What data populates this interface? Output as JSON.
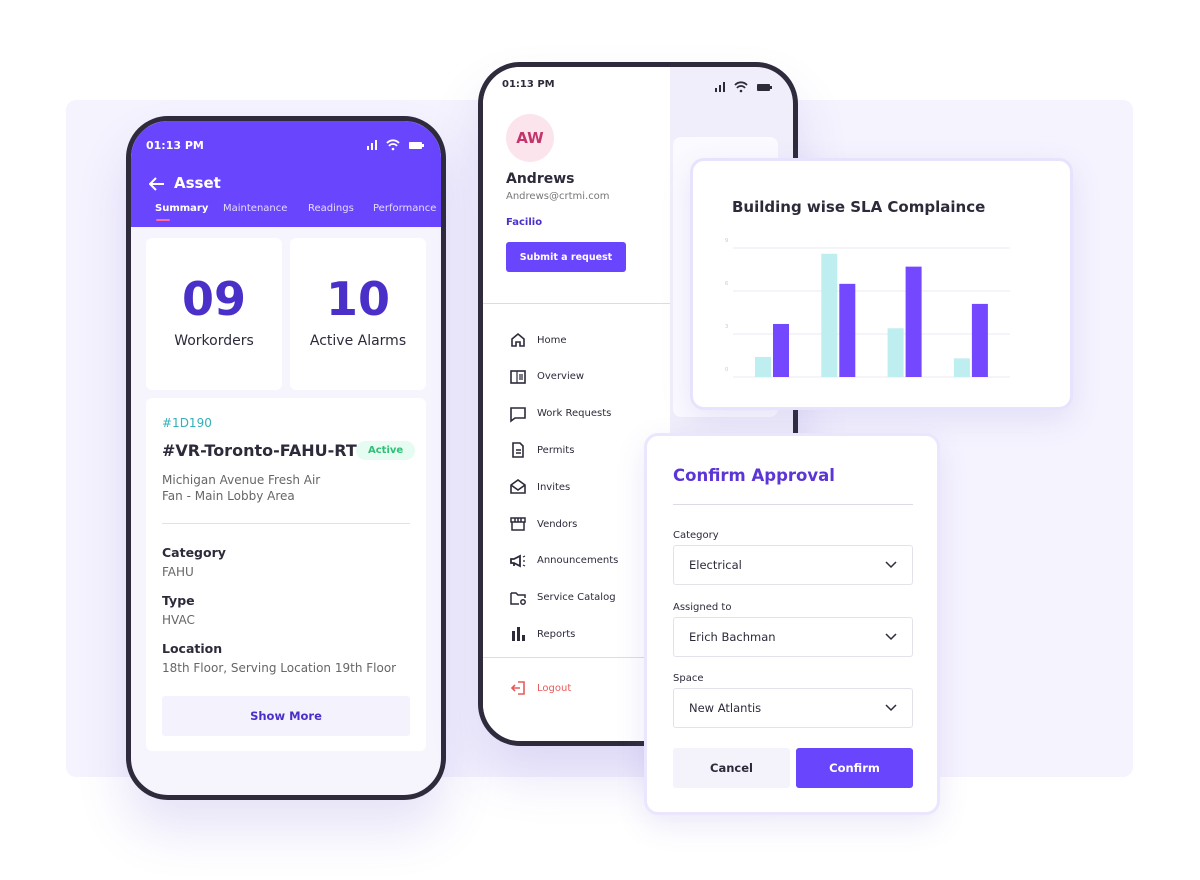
{
  "asset_screen": {
    "time": "01:13 PM",
    "title": "Asset",
    "tabs": [
      "Summary",
      "Maintenance",
      "Readings",
      "Performance"
    ],
    "stats": [
      {
        "value": "09",
        "label": "Workorders"
      },
      {
        "value": "10",
        "label": "Active Alarms"
      }
    ],
    "id": "#1D190",
    "name": "#VR-Toronto-FAHU-RT",
    "status": "Active",
    "description_line1": "Michigan Avenue Fresh Air",
    "description_line2": "Fan - Main Lobby Area",
    "fields": [
      {
        "label": "Category",
        "value": "FAHU"
      },
      {
        "label": "Type",
        "value": "HVAC"
      },
      {
        "label": "Location",
        "value": "18th Floor, Serving Location 19th Floor"
      }
    ],
    "show_more": "Show More"
  },
  "menu_screen": {
    "time": "01:13 PM",
    "avatar_initials": "AW",
    "name": "Andrews",
    "email": "Andrews@crtmi.com",
    "org": "Facilio",
    "submit": "Submit a request",
    "items": [
      {
        "label": "Home",
        "icon": "home-icon"
      },
      {
        "label": "Overview",
        "icon": "overview-icon"
      },
      {
        "label": "Work Requests",
        "icon": "chat-icon"
      },
      {
        "label": "Permits",
        "icon": "document-icon"
      },
      {
        "label": "Invites",
        "icon": "envelope-icon"
      },
      {
        "label": "Vendors",
        "icon": "store-icon"
      },
      {
        "label": "Announcements",
        "icon": "megaphone-icon"
      },
      {
        "label": "Service Catalog",
        "icon": "folder-gear-icon"
      },
      {
        "label": "Reports",
        "icon": "bar-chart-icon"
      }
    ],
    "logout": "Logout"
  },
  "chart_data": {
    "type": "bar",
    "title": "Building wise SLA Complaince",
    "yticks": [
      "0",
      "3",
      "6",
      "9"
    ],
    "ylim": [
      0,
      9
    ],
    "grid": true,
    "series": [
      {
        "color": "#bfeef0",
        "values": [
          1.4,
          8.6,
          3.4,
          1.3
        ]
      },
      {
        "color": "#7448ff",
        "values": [
          3.7,
          6.5,
          7.7,
          5.1
        ]
      }
    ]
  },
  "confirm": {
    "title": "Confirm Approval",
    "fields": [
      {
        "label": "Category",
        "value": "Electrical"
      },
      {
        "label": "Assigned to",
        "value": "Erich Bachman"
      },
      {
        "label": "Space",
        "value": "New Atlantis"
      }
    ],
    "cancel": "Cancel",
    "confirm": "Confirm"
  },
  "colors": {
    "accent": "#6a45fe",
    "active_badge": "#e6fbf1",
    "logout": "#e85a5a"
  }
}
